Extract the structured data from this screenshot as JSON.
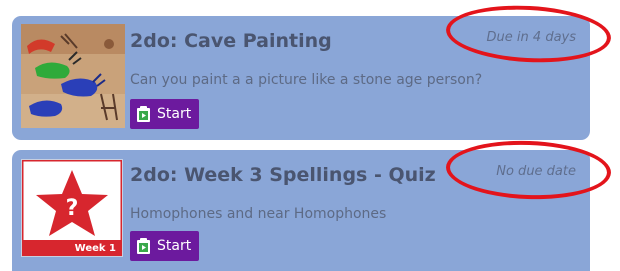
{
  "assignments": [
    {
      "title": "2do: Cave Painting",
      "description": "Can you paint a a picture like a stone age person?",
      "due": "Due in 4 days",
      "button_label": "Start",
      "thumbnail": "cave-painting-image"
    },
    {
      "title": "2do: Week 3 Spellings - Quiz",
      "description": "Homophones and near Homophones",
      "due": "No due date",
      "button_label": "Start",
      "thumbnail": "quiz-star-icon",
      "thumbnail_label": "Week 1"
    }
  ],
  "colors": {
    "card_background": "#8aa6d7",
    "button_background": "#6c1a9e",
    "highlight_ring": "#e3141b",
    "quiz_red": "#d7262e"
  }
}
